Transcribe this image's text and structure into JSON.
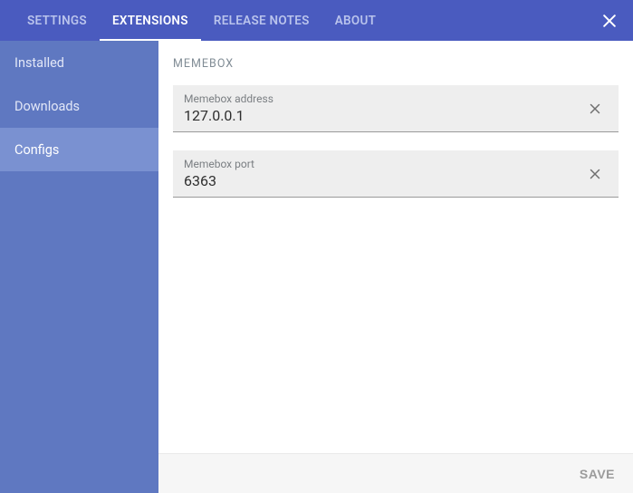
{
  "header": {
    "tabs": [
      {
        "label": "SETTINGS",
        "active": false
      },
      {
        "label": "EXTENSIONS",
        "active": true
      },
      {
        "label": "RELEASE NOTES",
        "active": false
      },
      {
        "label": "ABOUT",
        "active": false
      }
    ]
  },
  "sidebar": {
    "items": [
      {
        "label": "Installed",
        "active": false
      },
      {
        "label": "Downloads",
        "active": false
      },
      {
        "label": "Configs",
        "active": true
      }
    ]
  },
  "main": {
    "section_title": "MEMEBOX",
    "fields": [
      {
        "label": "Memebox address",
        "value": "127.0.0.1"
      },
      {
        "label": "Memebox port",
        "value": "6363"
      }
    ]
  },
  "footer": {
    "save_label": "SAVE"
  }
}
